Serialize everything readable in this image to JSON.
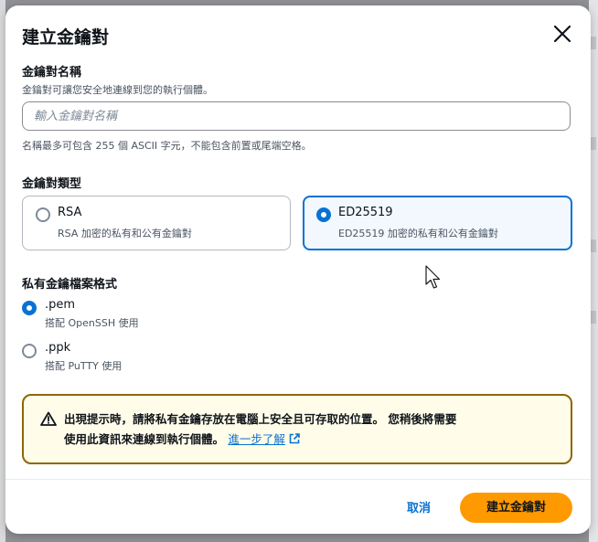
{
  "dialog": {
    "title": "建立金鑰對",
    "close_icon": "close-icon"
  },
  "key_name": {
    "label": "金鑰對名稱",
    "description": "金鑰對可讓您安全地連線到您的執行個體。",
    "placeholder": "輸入金鑰對名稱",
    "value": "",
    "constraint": "名稱最多可包含 255 個 ASCII 字元，不能包含前置或尾端空格。"
  },
  "key_type": {
    "label": "金鑰對類型",
    "options": [
      {
        "title": "RSA",
        "description": "RSA 加密的私有和公有金鑰對",
        "selected": false
      },
      {
        "title": "ED25519",
        "description": "ED25519 加密的私有和公有金鑰對",
        "selected": true
      }
    ]
  },
  "file_format": {
    "label": "私有金鑰檔案格式",
    "options": [
      {
        "title": ".pem",
        "description": "搭配 OpenSSH 使用",
        "selected": true
      },
      {
        "title": ".ppk",
        "description": "搭配 PuTTY 使用",
        "selected": false
      }
    ]
  },
  "alert": {
    "icon": "warning-icon",
    "line1": "出現提示時，請將私有金鑰存放在電腦上安全且可存取的位置。 您稍後將需要",
    "line2": "使用此資訊來連線到執行個體。",
    "link_text": "進一步了解",
    "link_icon": "external-link-icon"
  },
  "footer": {
    "cancel_label": "取消",
    "create_label": "建立金鑰對"
  },
  "colors": {
    "accent": "#0972d3",
    "primary_button": "#ff9900",
    "warning_border": "#8d6605",
    "warning_bg": "#fffce9"
  }
}
